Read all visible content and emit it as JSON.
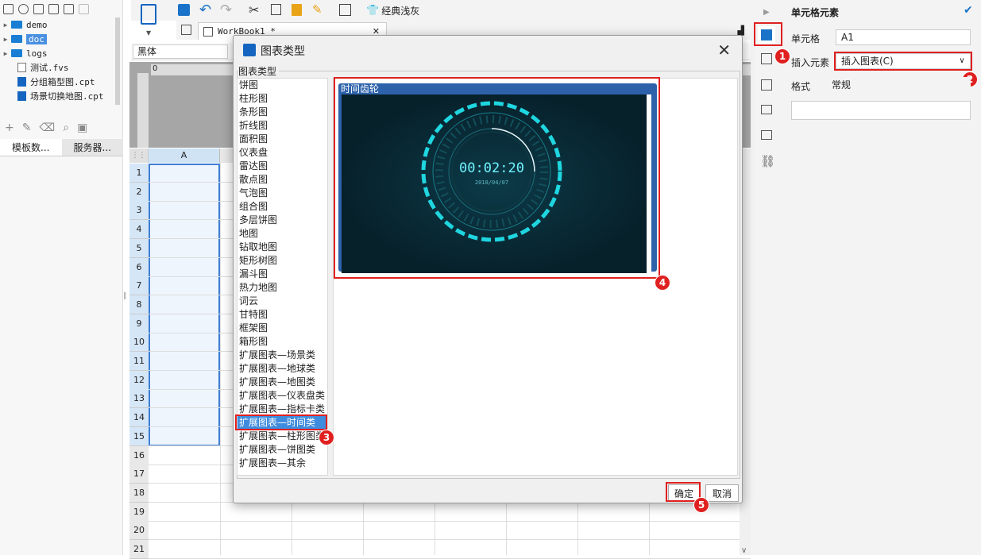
{
  "left_panel": {
    "tree": [
      {
        "name": "demo",
        "type": "folder"
      },
      {
        "name": "doc",
        "type": "folder",
        "selected": true
      },
      {
        "name": "logs",
        "type": "folder"
      },
      {
        "name": "测试.fvs",
        "type": "file"
      },
      {
        "name": "分组箱型图.cpt",
        "type": "cpt"
      },
      {
        "name": "场景切换地图.cpt",
        "type": "cpt"
      }
    ],
    "tabs": [
      "模板数...",
      "服务器..."
    ]
  },
  "toolbar": {
    "theme_label": "经典浅灰"
  },
  "editor_tab": "WorkBook1 *",
  "font_name": "黑体",
  "sheet": {
    "column_header": "A",
    "rows": [
      "1",
      "2",
      "3",
      "4",
      "5",
      "6",
      "7",
      "8",
      "9",
      "10",
      "11",
      "12",
      "13",
      "14",
      "15",
      "16",
      "17",
      "18",
      "19",
      "20",
      "21"
    ]
  },
  "right_panel": {
    "title": "单元格元素",
    "cell_label": "单元格",
    "cell_value": "A1",
    "insert_label": "插入元素",
    "insert_value": "插入图表(C)",
    "format_label": "格式",
    "format_value": "常规"
  },
  "dialog": {
    "title": "图表类型",
    "group_label": "图表类型",
    "chart_types": [
      "饼图",
      "柱形图",
      "条形图",
      "折线图",
      "面积图",
      "仪表盘",
      "雷达图",
      "散点图",
      "气泡图",
      "组合图",
      "多层饼图",
      "地图",
      "钻取地图",
      "矩形树图",
      "漏斗图",
      "热力地图",
      "词云",
      "甘特图",
      "框架图",
      "箱形图",
      "扩展图表—场景类",
      "扩展图表—地球类",
      "扩展图表—地图类",
      "扩展图表—仪表盘类",
      "扩展图表—指标卡类",
      "扩展图表—时间类",
      "扩展图表—柱形图类",
      "扩展图表—饼图类",
      "扩展图表—其余"
    ],
    "selected_index": 25,
    "preview_title": "时间齿轮",
    "preview_time": "00:02:20",
    "preview_date": "2018/04/07",
    "ok_label": "确定",
    "cancel_label": "取消"
  },
  "badges": [
    "1",
    "2",
    "3",
    "4",
    "5"
  ],
  "colors": {
    "accent": "#3f8cde",
    "highlight": "#e02020",
    "preview_bg": "#07212b",
    "gear_cyan": "#1fd6e0"
  }
}
